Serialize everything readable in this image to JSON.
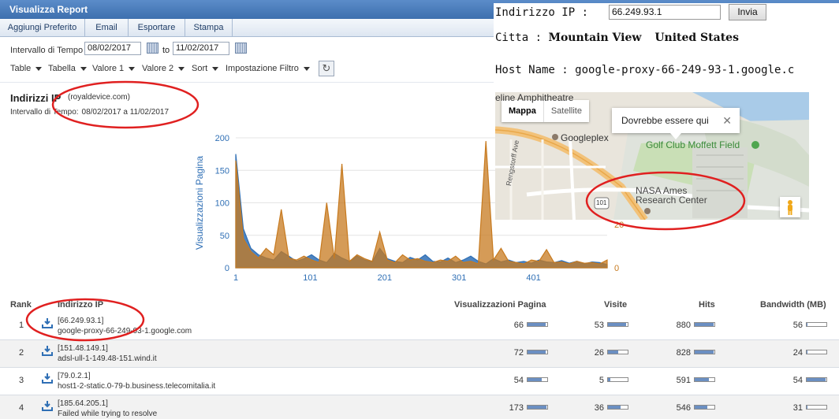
{
  "window": {
    "title": "Visualizza Report"
  },
  "tabs": [
    {
      "label": "Aggiungi Preferito"
    },
    {
      "label": "Email"
    },
    {
      "label": "Esportare"
    },
    {
      "label": "Stampa"
    }
  ],
  "date_filter": {
    "label": "Intervallo di Tempo",
    "from": "08/02/2017",
    "to_label": "to",
    "to": "11/02/2017"
  },
  "filters": [
    {
      "label": "Table"
    },
    {
      "label": "Tabella"
    },
    {
      "label": "Valore 1"
    },
    {
      "label": "Valore 2"
    },
    {
      "label": "Sort"
    },
    {
      "label": "Impostazione Filtro"
    }
  ],
  "report": {
    "title": "Indirizzi IP",
    "domain": "(royaldevice.com)",
    "range_label": "Intervallo di Tempo:",
    "range_value": "08/02/2017 a 11/02/2017"
  },
  "colors": {
    "accent": "#3d6fae",
    "series_blue": "#2f6fb5",
    "series_orange": "#c77a1f",
    "annotation": "#e02020"
  },
  "chart_data": {
    "type": "area",
    "ylabel": "Visualizzazioni Pagina",
    "y_left_ticks": [
      "0",
      "50",
      "100",
      "150",
      "200"
    ],
    "y_right_ticks": [
      "0",
      "20"
    ],
    "x_ticks": [
      "1",
      "101",
      "201",
      "301",
      "401"
    ],
    "ylim": [
      0,
      200
    ],
    "xlim": [
      1,
      500
    ],
    "series": [
      {
        "color": "#2f6fb5",
        "values": [
          175,
          60,
          30,
          20,
          15,
          12,
          25,
          18,
          10,
          14,
          20,
          12,
          8,
          22,
          15,
          10,
          18,
          12,
          9,
          30,
          14,
          10,
          8,
          16,
          12,
          20,
          10,
          9,
          15,
          8,
          12,
          18,
          10,
          6,
          14,
          9,
          12,
          8,
          10,
          7,
          12,
          9,
          8,
          11,
          7,
          10,
          6,
          9,
          8,
          5
        ]
      },
      {
        "color": "#c77a1f",
        "values": [
          165,
          45,
          25,
          15,
          30,
          20,
          90,
          15,
          12,
          18,
          12,
          8,
          100,
          14,
          160,
          10,
          20,
          14,
          10,
          55,
          12,
          8,
          20,
          12,
          14,
          10,
          8,
          12,
          10,
          18,
          8,
          10,
          6,
          195,
          12,
          30,
          10,
          8,
          6,
          12,
          10,
          28,
          8,
          9,
          6,
          10,
          7,
          8,
          6,
          12
        ]
      }
    ]
  },
  "table": {
    "headers": {
      "rank": "Rank",
      "ip": "Indirizzo IP",
      "views": "Visualizzazioni Pagina",
      "visits": "Visite",
      "hits": "Hits",
      "bandwidth": "Bandwidth (MB)"
    },
    "rows": [
      {
        "rank": "1",
        "ip": "[66.249.93.1]",
        "host": "google-proxy-66-249-93-1.google.com",
        "views": "66",
        "views_fill": 0.9,
        "visits": "53",
        "visits_fill": 0.9,
        "hits": "880",
        "hits_fill": 0.95,
        "bandwidth": "56",
        "bandwidth_fill": 0.05
      },
      {
        "rank": "2",
        "ip": "[151.48.149.1]",
        "host": "adsl-ull-1-149.48-151.wind.it",
        "views": "72",
        "views_fill": 0.9,
        "visits": "26",
        "visits_fill": 0.5,
        "hits": "828",
        "hits_fill": 0.95,
        "bandwidth": "24",
        "bandwidth_fill": 0.05
      },
      {
        "rank": "3",
        "ip": "[79.0.2.1]",
        "host": "host1-2-static.0-79-b.business.telecomitalia.it",
        "views": "54",
        "views_fill": 0.7,
        "visits": "5",
        "visits_fill": 0.1,
        "hits": "591",
        "hits_fill": 0.7,
        "bandwidth": "54",
        "bandwidth_fill": 0.95
      },
      {
        "rank": "4",
        "ip": "[185.64.205.1]",
        "host": "Failed while trying to resolve",
        "views": "173",
        "views_fill": 0.95,
        "visits": "36",
        "visits_fill": 0.65,
        "hits": "546",
        "hits_fill": 0.65,
        "bandwidth": "31",
        "bandwidth_fill": 0.05
      }
    ]
  },
  "lookup": {
    "ip_label": "Indirizzo IP :",
    "ip_value": "66.249.93.1",
    "submit": "Invia",
    "city_label": "Citta :",
    "city": "Mountain View",
    "country": "United States",
    "host_label": "Host Name :",
    "host": "google-proxy-66-249-93-1.google.c"
  },
  "map": {
    "btn_map": "Mappa",
    "btn_sat": "Satellite",
    "bubble": "Dovrebbe essere qui",
    "labels": {
      "amphitheatre": "eline Amphitheatre",
      "googleplex": "Googleplex",
      "golf": "Golf Club Moffett Field",
      "nasa_1": "NASA Ames",
      "nasa_2": "Research Center",
      "street": "Rengstorff Ave",
      "route": "101"
    }
  }
}
